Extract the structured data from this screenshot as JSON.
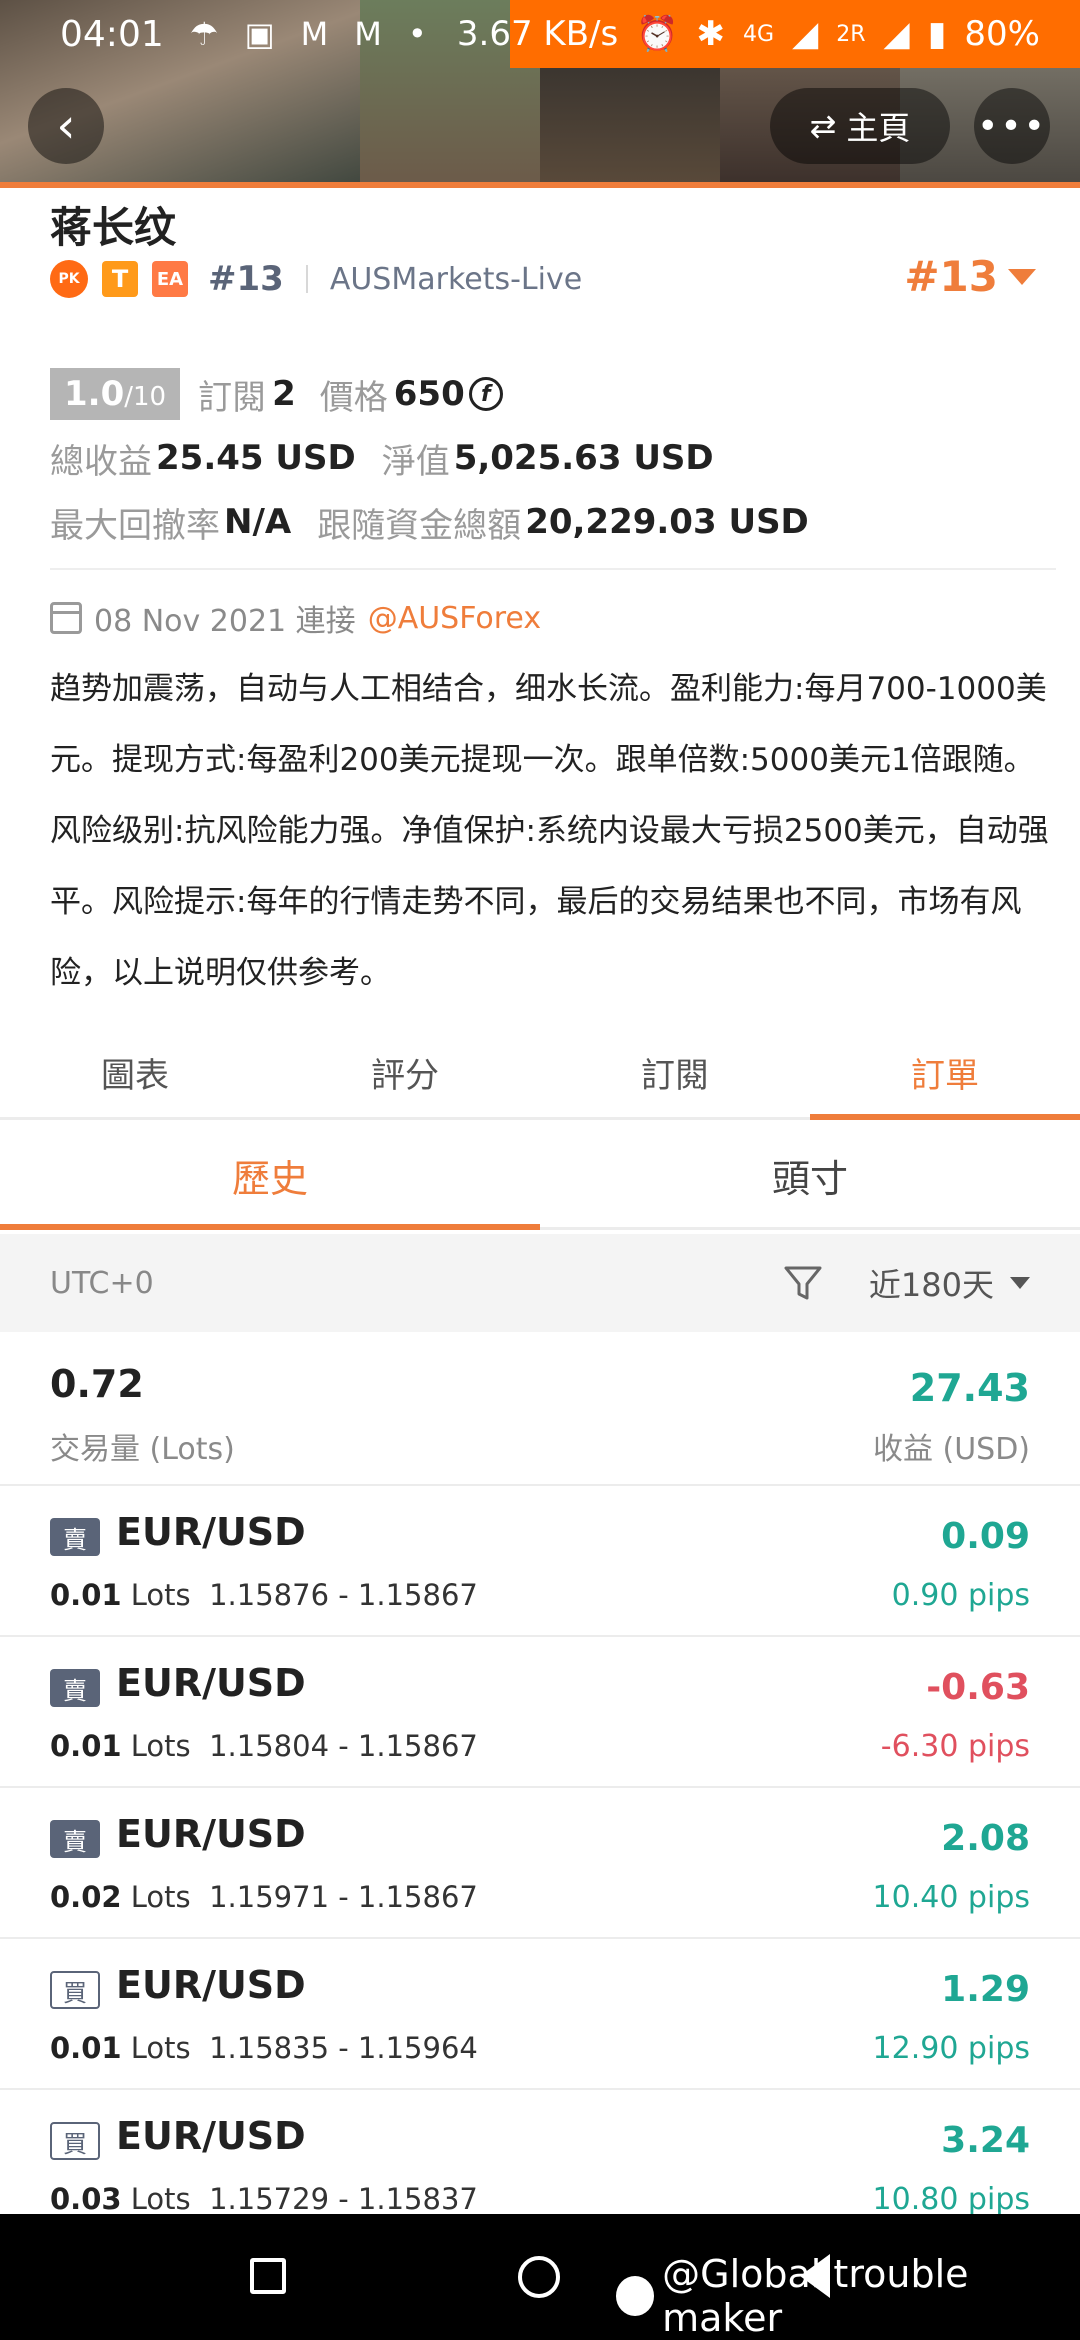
{
  "status_bar": {
    "time": "04:01",
    "network_speed": "3.67 KB/s",
    "signal_1": "4G",
    "signal_2": "2R",
    "battery": "80%"
  },
  "header": {
    "home_label": "主頁"
  },
  "profile": {
    "name": "蒋长纹",
    "badge_pk": "PK",
    "badge_t": "T",
    "badge_ea": "EA",
    "rank_small": "#13",
    "server": "AUSMarkets-Live",
    "rank_big": "#13"
  },
  "stats": {
    "score": "1.0",
    "score_total": "/10",
    "subscribe_label": "訂閱",
    "subscribe_value": "2",
    "price_label": "價格",
    "price_value": "650",
    "total_profit_label": "總收益",
    "total_profit_value": "25.45 USD",
    "equity_label": "淨值",
    "equity_value": "5,025.63 USD",
    "max_drawdown_label": "最大回撤率",
    "max_drawdown_value": "N/A",
    "follow_total_label": "跟隨資金總額",
    "follow_total_value": "20,229.03 USD"
  },
  "connect": {
    "date": "08 Nov 2021 連接",
    "mention": "@AUSForex"
  },
  "description": "趋势加震荡，自动与人工相结合，细水长流。盈利能力:每月700-1000美元。提现方式:每盈利200美元提现一次。跟单倍数:5000美元1倍跟随。风险级别:抗风险能力强。净值保护:系统内设最大亏损2500美元，自动强平。风险提示:每年的行情走势不同，最后的交易结果也不同，市场有风险，以上说明仅供参考。",
  "tabs": [
    "圖表",
    "評分",
    "訂閱",
    "訂單"
  ],
  "subtabs": [
    "歷史",
    "頭寸"
  ],
  "filter": {
    "timezone": "UTC+0",
    "range": "近180天"
  },
  "summary": {
    "lots_value": "0.72",
    "lots_label": "交易量 (Lots)",
    "profit_value": "27.43",
    "profit_label": "收益 (USD)"
  },
  "orders": [
    {
      "side": "賣",
      "type": "sell",
      "pair": "EUR/USD",
      "lots": "0.01",
      "lots_unit": "Lots",
      "prices": "1.15876 - 1.15867",
      "profit": "0.09",
      "pips": "0.90 pips",
      "positive": true
    },
    {
      "side": "賣",
      "type": "sell",
      "pair": "EUR/USD",
      "lots": "0.01",
      "lots_unit": "Lots",
      "prices": "1.15804 - 1.15867",
      "profit": "-0.63",
      "pips": "-6.30 pips",
      "positive": false
    },
    {
      "side": "賣",
      "type": "sell",
      "pair": "EUR/USD",
      "lots": "0.02",
      "lots_unit": "Lots",
      "prices": "1.15971 - 1.15867",
      "profit": "2.08",
      "pips": "10.40 pips",
      "positive": true
    },
    {
      "side": "買",
      "type": "buy",
      "pair": "EUR/USD",
      "lots": "0.01",
      "lots_unit": "Lots",
      "prices": "1.15835 - 1.15964",
      "profit": "1.29",
      "pips": "12.90 pips",
      "positive": true
    },
    {
      "side": "買",
      "type": "buy",
      "pair": "EUR/USD",
      "lots": "0.03",
      "lots_unit": "Lots",
      "prices": "1.15729 - 1.15837",
      "profit": "3.24",
      "pips": "10.80 pips",
      "positive": true
    }
  ],
  "watermark": "@Global trouble maker",
  "colors": {
    "accent": "#ef7d3b",
    "positive": "#1fa793",
    "negative": "#e0505e",
    "badge_dark": "#5a6478"
  }
}
